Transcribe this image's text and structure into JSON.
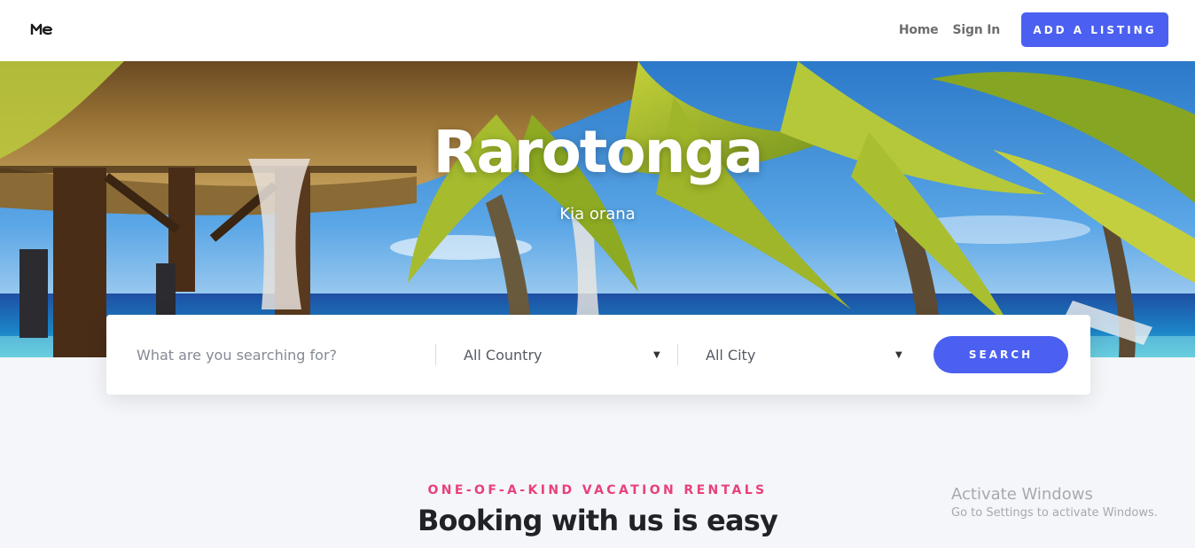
{
  "nav": {
    "logo_icon": "me-logo-icon",
    "links": [
      "Home",
      "Sign In"
    ],
    "cta_label": "ADD A LISTING",
    "accent_color": "#4b60f0"
  },
  "hero": {
    "title": "Rarotonga",
    "subtitle": "Kia orana",
    "background_image": "tropical-beach-palms-thatched-cabana"
  },
  "search": {
    "placeholder": "What are you searching for?",
    "country_select": {
      "selected": "All Country"
    },
    "city_select": {
      "selected": "All City"
    },
    "button_label": "SEARCH",
    "caret_icon": "caret-down-icon"
  },
  "section": {
    "kicker": "ONE-OF-A-KIND VACATION RENTALS",
    "kicker_color": "#e8407b",
    "title": "Booking with us is easy"
  },
  "watermark": {
    "title": "Activate Windows",
    "subtitle": "Go to Settings to activate Windows."
  }
}
